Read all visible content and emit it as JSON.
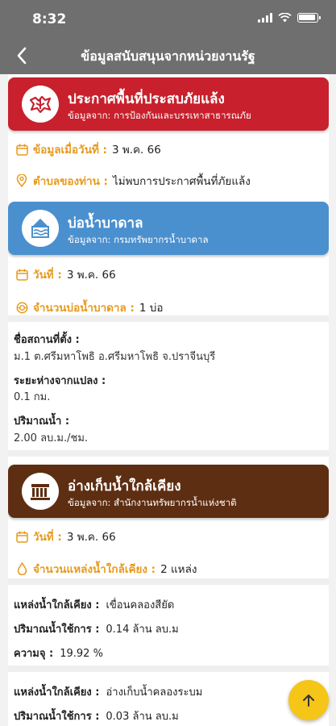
{
  "status_bar": {
    "time": "8:32"
  },
  "header": {
    "title": "ข้อมูลสนับสนุนจากหน่วยงานรัฐ"
  },
  "drought": {
    "title": "ประกาศพื้นที่ประสบภัยแล้ง",
    "source": "ข้อมูลจาก: การป้องกันและบรรเทาสาธารณภัย",
    "date_label": "ข้อมูลเมื่อวันที่ :",
    "date_value": "3 พ.ค. 66",
    "subdistrict_label": "ตำบลของท่าน :",
    "subdistrict_value": "ไม่พบการประกาศพื้นที่ภัยแล้ง"
  },
  "groundwater": {
    "title": "บ่อน้ำบาดาล",
    "source": "ข้อมูลจาก: กรมทรัพยากรน้ำบาดาล",
    "date_label": "วันที่ :",
    "date_value": "3 พ.ค. 66",
    "count_label": "จำนวนบ่อน้ำบาดาล :",
    "count_value": "1 บ่อ",
    "location_label": "ชื่อสถานที่ตั้ง :",
    "location_value": "ม.1 ต.ศรีมหาโพธิ อ.ศรีมหาโพธิ จ.ปราจีนบุรี",
    "distance_label": "ระยะห่างจากแปลง :",
    "distance_value": "0.1 กม.",
    "volume_label": "ปริมาณน้ำ :",
    "volume_value": "2.00 ลบ.ม./ชม."
  },
  "reservoir": {
    "title": "อ่างเก็บน้ำใกล้เคียง",
    "source": "ข้อมูลจาก: สำนักงานทรัพยากรน้ำแห่งชาติ",
    "date_label": "วันที่ :",
    "date_value": "3 พ.ค. 66",
    "count_label": "จำนวนแหล่งน้ำใกล้เคียง :",
    "count_value": "2 แหล่ง",
    "items": [
      {
        "source_label": "แหล่งน้ำใกล้เคียง :",
        "source_value": "เขื่อนคลองสียัด",
        "usable_label": "ปริมาณน้ำใช้การ :",
        "usable_value": "0.14 ล้าน ลบ.ม",
        "capacity_label": "ความจุ :",
        "capacity_value": "19.92 %"
      },
      {
        "source_label": "แหล่งน้ำใกล้เคียง :",
        "source_value": "อ่างเก็บน้ำคลองระบม",
        "usable_label": "ปริมาณน้ำใช้การ :",
        "usable_value": "0.03 ล้าน ลบ.ม"
      }
    ]
  },
  "colors": {
    "header": "#6f6f6f",
    "drought": "#c8202c",
    "groundwater": "#4a90cf",
    "reservoir": "#5e2e12",
    "label_accent": "#e79a1d",
    "fab": "#f5c518"
  },
  "icons": [
    "back-arrow-icon",
    "signal-icon",
    "wifi-icon",
    "battery-icon",
    "calendar-icon",
    "location-pin-icon",
    "well-icon",
    "water-drop-icon",
    "arrow-up-icon"
  ]
}
